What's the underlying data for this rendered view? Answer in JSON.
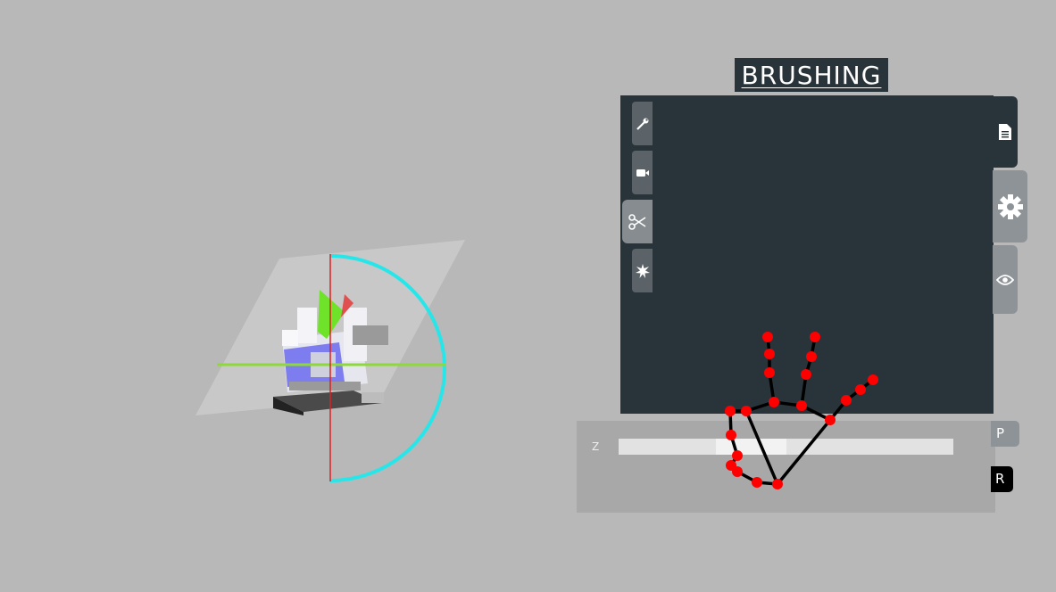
{
  "header": {
    "title": "BRUSHING"
  },
  "toolbar": {
    "tools": [
      {
        "icon": "wrench-icon",
        "active": false
      },
      {
        "icon": "camera-icon",
        "active": false
      },
      {
        "icon": "scissors-icon",
        "active": true
      },
      {
        "icon": "explode-icon",
        "active": false
      }
    ]
  },
  "side_tabs": [
    {
      "icon": "document-icon"
    },
    {
      "icon": "gear-icon"
    },
    {
      "icon": "eye-icon"
    }
  ],
  "slider": {
    "label": "Z"
  },
  "mode_buttons": {
    "p_label": "P",
    "r_label": "R"
  },
  "colors": {
    "background": "#b8b8b8",
    "panel": "#29343a",
    "gizmo_ring": "#27e6ea",
    "axis_x": "#7ed321",
    "axis_y": "#e02020",
    "hand_joint": "#ff0000",
    "hand_bone": "#000000"
  }
}
